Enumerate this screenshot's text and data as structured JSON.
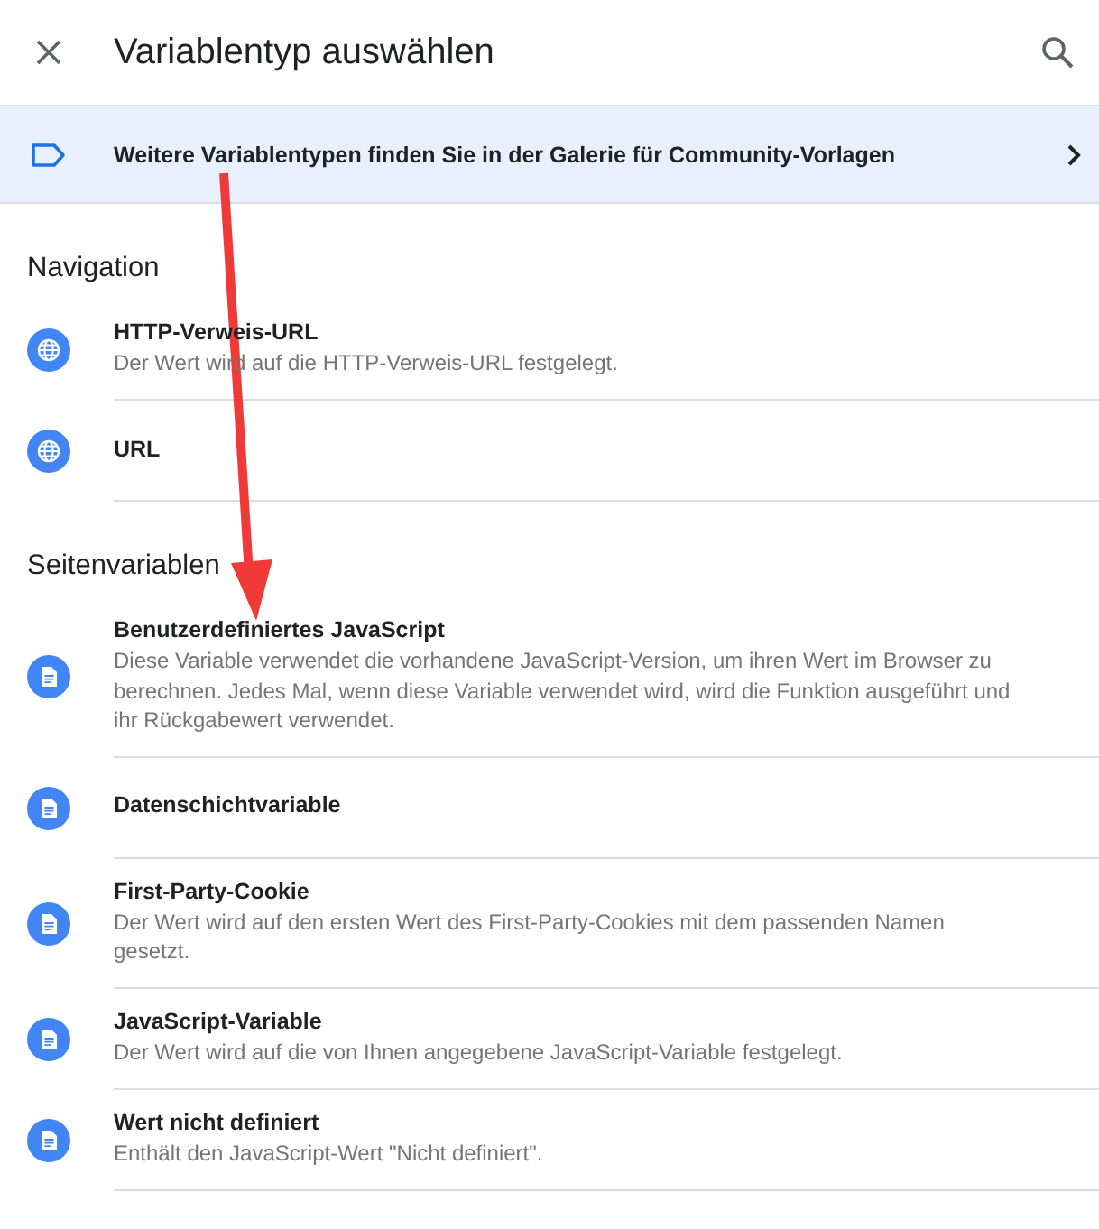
{
  "header": {
    "title": "Variablentyp auswählen"
  },
  "banner": {
    "text": "Weitere Variablentypen finden Sie in der Galerie für Community-Vorlagen"
  },
  "sections": [
    {
      "title": "Navigation",
      "items": [
        {
          "kind": "navigation",
          "title": "HTTP-Verweis-URL",
          "description": "Der Wert wird auf die HTTP-Verweis-URL festgelegt."
        },
        {
          "kind": "navigation",
          "title": "URL"
        }
      ]
    },
    {
      "title": "Seitenvariablen",
      "items": [
        {
          "kind": "page",
          "title": "Benutzerdefiniertes JavaScript",
          "description": "Diese Variable verwendet die vorhandene JavaScript-Version, um ihren Wert im Browser zu berechnen. Jedes Mal, wenn diese Variable verwendet wird, wird die Funktion ausgeführt und ihr Rückgabewert verwendet."
        },
        {
          "kind": "page",
          "title": "Datenschichtvariable"
        },
        {
          "kind": "page",
          "title": "First-Party-Cookie",
          "description": "Der Wert wird auf den ersten Wert des First-Party-Cookies mit dem passenden Namen gesetzt."
        },
        {
          "kind": "page",
          "title": "JavaScript-Variable",
          "description": "Der Wert wird auf die von Ihnen angegebene JavaScript-Variable festgelegt."
        },
        {
          "kind": "page",
          "title": "Wert nicht definiert",
          "description": "Enthält den JavaScript-Wert \"Nicht definiert\"."
        }
      ]
    }
  ]
}
